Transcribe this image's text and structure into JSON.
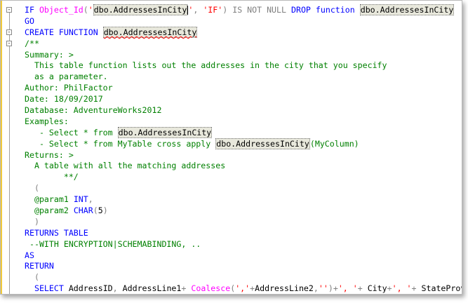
{
  "editor": {
    "lines": [
      {
        "fold": "-",
        "tokens": [
          {
            "t": "IF ",
            "c": "kw"
          },
          {
            "t": "Object_Id",
            "c": "fn"
          },
          {
            "t": "(",
            "c": "gray"
          },
          {
            "t": "'",
            "c": "str"
          },
          {
            "t": "dbo.AddressesInCity",
            "c": "txt",
            "hl": true
          },
          {
            "t": "|",
            "c": "caret"
          },
          {
            "t": "'",
            "c": "str"
          },
          {
            "t": ", ",
            "c": "gray"
          },
          {
            "t": "'IF'",
            "c": "str"
          },
          {
            "t": ") ",
            "c": "gray"
          },
          {
            "t": "IS NOT NULL ",
            "c": "gray"
          },
          {
            "t": "DROP function ",
            "c": "kw"
          },
          {
            "t": "dbo.AddressesInCity",
            "c": "txt",
            "hl": true
          }
        ]
      },
      {
        "fold": "",
        "tokens": [
          {
            "t": "GO",
            "c": "kw"
          }
        ]
      },
      {
        "fold": "-",
        "tokens": [
          {
            "t": "CREATE FUNCTION ",
            "c": "kw"
          },
          {
            "t": "dbo.AddressesInCity",
            "c": "txt",
            "hl": true,
            "squig": true
          }
        ]
      },
      {
        "fold": "-",
        "tokens": [
          {
            "t": "/**",
            "c": "cmt"
          }
        ]
      },
      {
        "fold": "",
        "tokens": [
          {
            "t": "Summary: >",
            "c": "cmt"
          }
        ]
      },
      {
        "fold": "",
        "tokens": [
          {
            "t": "  This table function lists out the addresses in the city that you specify",
            "c": "cmt"
          }
        ]
      },
      {
        "fold": "",
        "tokens": [
          {
            "t": "  as a parameter.",
            "c": "cmt"
          }
        ]
      },
      {
        "fold": "",
        "tokens": [
          {
            "t": "Author: PhilFactor",
            "c": "cmt"
          }
        ]
      },
      {
        "fold": "",
        "tokens": [
          {
            "t": "Date: 18/09/2017",
            "c": "cmt"
          }
        ]
      },
      {
        "fold": "",
        "tokens": [
          {
            "t": "Database: AdventureWorks2012",
            "c": "cmt"
          }
        ]
      },
      {
        "fold": "",
        "tokens": [
          {
            "t": "Examples:",
            "c": "cmt"
          }
        ]
      },
      {
        "fold": "",
        "tokens": [
          {
            "t": "   - Select * from ",
            "c": "cmt"
          },
          {
            "t": "dbo.AddressesInCity",
            "c": "txt",
            "hl": true
          }
        ]
      },
      {
        "fold": "",
        "tokens": [
          {
            "t": "   - Select * from MyTable cross apply ",
            "c": "cmt"
          },
          {
            "t": "dbo.AddressesInCity",
            "c": "txt",
            "hl": true
          },
          {
            "t": "(MyColumn)",
            "c": "cmt"
          }
        ]
      },
      {
        "fold": "",
        "tokens": [
          {
            "t": "Returns: >",
            "c": "cmt"
          }
        ]
      },
      {
        "fold": "",
        "tokens": [
          {
            "t": "  A table with all the matching addresses",
            "c": "cmt"
          }
        ]
      },
      {
        "fold": "",
        "tokens": [
          {
            "t": "        **/",
            "c": "cmt"
          }
        ]
      },
      {
        "fold": "",
        "tokens": [
          {
            "t": "  (",
            "c": "gray"
          }
        ]
      },
      {
        "fold": "",
        "tokens": [
          {
            "t": "  @param1 ",
            "c": "cmt"
          },
          {
            "t": "INT",
            "c": "kw"
          },
          {
            "t": ",",
            "c": "gray"
          }
        ]
      },
      {
        "fold": "",
        "tokens": [
          {
            "t": "  @param2 ",
            "c": "cmt"
          },
          {
            "t": "CHAR",
            "c": "kw"
          },
          {
            "t": "(",
            "c": "gray"
          },
          {
            "t": "5",
            "c": "txt"
          },
          {
            "t": ")",
            "c": "gray"
          }
        ]
      },
      {
        "fold": "",
        "tokens": [
          {
            "t": "  )",
            "c": "gray"
          }
        ]
      },
      {
        "fold": "",
        "tokens": [
          {
            "t": "RETURNS TABLE",
            "c": "kw"
          }
        ]
      },
      {
        "fold": "",
        "tokens": [
          {
            "t": " --WITH ENCRYPTION|SCHEMABINDING, ..",
            "c": "cmt"
          }
        ]
      },
      {
        "fold": "",
        "tokens": [
          {
            "t": "AS",
            "c": "kw"
          }
        ]
      },
      {
        "fold": "",
        "tokens": [
          {
            "t": "RETURN",
            "c": "kw"
          }
        ]
      },
      {
        "fold": "",
        "tokens": [
          {
            "t": "  (",
            "c": "gray"
          }
        ]
      },
      {
        "fold": "",
        "tokens": [
          {
            "t": "  SELECT ",
            "c": "kw"
          },
          {
            "t": "AddressID",
            "c": "txt"
          },
          {
            "t": ", ",
            "c": "gray"
          },
          {
            "t": "AddressLine1",
            "c": "txt"
          },
          {
            "t": "+ ",
            "c": "gray"
          },
          {
            "t": "Coalesce",
            "c": "fn"
          },
          {
            "t": "(",
            "c": "gray"
          },
          {
            "t": "','",
            "c": "str"
          },
          {
            "t": "+",
            "c": "gray"
          },
          {
            "t": "AddressLine2",
            "c": "txt"
          },
          {
            "t": ",",
            "c": "gray"
          },
          {
            "t": "''",
            "c": "str"
          },
          {
            "t": ")+",
            "c": "gray"
          },
          {
            "t": "', '",
            "c": "str"
          },
          {
            "t": "+ ",
            "c": "gray"
          },
          {
            "t": "City",
            "c": "txt"
          },
          {
            "t": "+",
            "c": "gray"
          },
          {
            "t": "', '",
            "c": "str"
          },
          {
            "t": "+ ",
            "c": "gray"
          },
          {
            "t": "StateProv",
            "c": "txt"
          }
        ]
      }
    ]
  }
}
